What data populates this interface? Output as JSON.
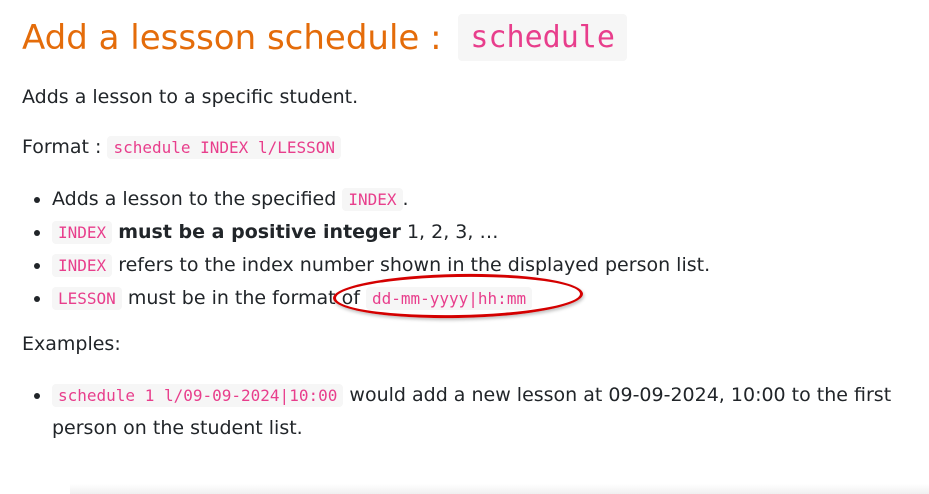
{
  "heading": {
    "text": "Add a lessson schedule :",
    "command": "schedule"
  },
  "intro": "Adds a lesson to a specific student.",
  "format": {
    "label": "Format :",
    "code": "schedule INDEX l/LESSON"
  },
  "details": {
    "item1": {
      "text": "Adds a lesson to the specified",
      "code": "INDEX",
      "after": "."
    },
    "item2": {
      "code": "INDEX",
      "bold": "must be a positive integer",
      "after": "1, 2, 3, …"
    },
    "item3": {
      "code": "INDEX",
      "after": "refers to the index number shown in the displayed person list."
    },
    "item4": {
      "code": "LESSON",
      "text": "must be in the format of",
      "format_code": "dd-mm-yyyy|hh:mm"
    }
  },
  "examples_label": "Examples:",
  "examples": {
    "item1": {
      "code": "schedule 1 l/09-09-2024|10:00",
      "text": "would add a new lesson at 09-09-2024, 10:00 to the first person on the student list."
    }
  },
  "colors": {
    "heading": "#e46c0a",
    "code_text": "#e83e8c",
    "code_bg": "#f6f6f6",
    "annotation": "#d40000"
  }
}
